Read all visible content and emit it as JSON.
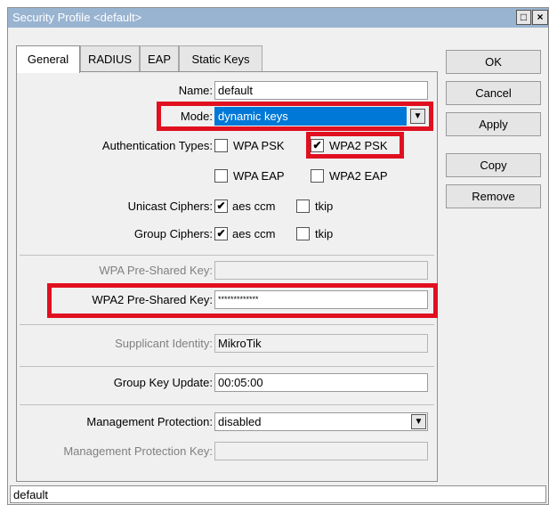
{
  "window": {
    "title": "Security Profile <default>"
  },
  "tabs": [
    "General",
    "RADIUS",
    "EAP",
    "Static Keys"
  ],
  "form": {
    "name": {
      "label": "Name:",
      "value": "default"
    },
    "mode": {
      "label": "Mode:",
      "value": "dynamic keys"
    },
    "auth_types": {
      "label": "Authentication Types:",
      "options": [
        {
          "label": "WPA PSK",
          "checked": false
        },
        {
          "label": "WPA2 PSK",
          "checked": true
        },
        {
          "label": "WPA EAP",
          "checked": false
        },
        {
          "label": "WPA2 EAP",
          "checked": false
        }
      ]
    },
    "unicast_ciphers": {
      "label": "Unicast Ciphers:",
      "options": [
        {
          "label": "aes ccm",
          "checked": true
        },
        {
          "label": "tkip",
          "checked": false
        }
      ]
    },
    "group_ciphers": {
      "label": "Group Ciphers:",
      "options": [
        {
          "label": "aes ccm",
          "checked": true
        },
        {
          "label": "tkip",
          "checked": false
        }
      ]
    },
    "wpa_psk": {
      "label": "WPA Pre-Shared Key:",
      "value": ""
    },
    "wpa2_psk": {
      "label": "WPA2 Pre-Shared Key:",
      "value": "*************"
    },
    "supplicant_identity": {
      "label": "Supplicant Identity:",
      "value": "MikroTik"
    },
    "group_key_update": {
      "label": "Group Key Update:",
      "value": "00:05:00"
    },
    "management_protection": {
      "label": "Management Protection:",
      "value": "disabled"
    },
    "management_protection_key": {
      "label": "Management Protection Key:",
      "value": ""
    }
  },
  "buttons": [
    "OK",
    "Cancel",
    "Apply",
    "Copy",
    "Remove"
  ],
  "status": "default",
  "icons": {
    "dropdown": "dropdown-arrow-icon",
    "checkmark": "checkmark-icon",
    "maximize": "maximize-icon",
    "close": "close-icon"
  },
  "colors": {
    "title_bar": "#99b4d1",
    "selection": "#0078d7",
    "highlight": "#e01020"
  }
}
